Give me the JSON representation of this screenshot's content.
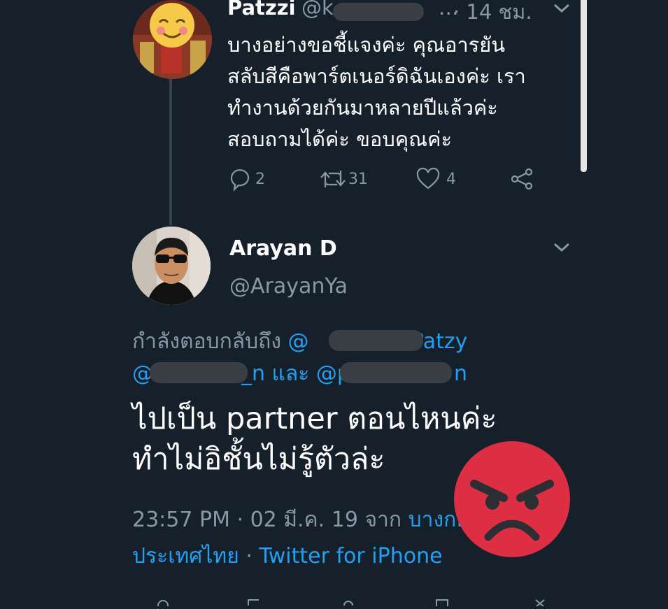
{
  "tweet1": {
    "name": "Patzzi",
    "handle_prefix": "@k",
    "handle_suffix": "…",
    "time": "· 14 ชม.",
    "text": "บางอย่างขอชี้แจงค่ะ คุณอารยัน\nสลับสีคือพาร์ตเนอร์ดิฉันเองค่ะ เรา\nทำงานด้วยกันมาหลายปีแล้วค่ะ\nสอบถามได้ค่ะ ขอบคุณค่ะ",
    "replies": "2",
    "retweets": "31",
    "likes": "4"
  },
  "tweet2": {
    "name": "Arayan D",
    "handle": "@ArayanYa",
    "reply_prefix": "กำลังตอบกลับถึง ",
    "mention1_start": "@",
    "mention1_end": "ePatzy",
    "mention2_start": "@",
    "mention2_end": "_n",
    "and_word": " และ ",
    "mention3_start": "@p",
    "mention3_end": "n",
    "text": "ไปเป็น partner ตอนไหนค่ะ\nทำไม่อิชั้นไม่รู้ตัวล่ะ",
    "time": "23:57 PM · 02 มี.ค. 19 จาก ",
    "location": "บางกอก ประเทศไทย",
    "separator": " · ",
    "source": "Twitter for iPhone"
  },
  "icons": {
    "reply": "reply-icon",
    "retweet": "retweet-icon",
    "like": "heart-icon",
    "share": "share-icon",
    "chevron": "chevron-down-icon",
    "emoji_overlay": "angry-face-emoji"
  },
  "colors": {
    "background": "#15202b",
    "link": "#1da1f2",
    "secondary_text": "#8899a6",
    "emoji_red": "#dd2e44"
  }
}
